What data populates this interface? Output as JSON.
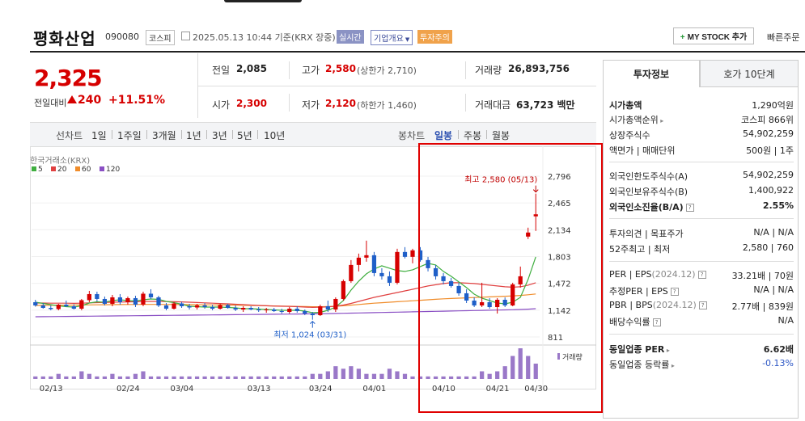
{
  "header": {
    "stock_name": "평화산업",
    "stock_code": "090080",
    "market": "코스피",
    "datetime": "2025.05.13 10:44 기준(KRX 장중)",
    "badges": [
      "실시간",
      "기업개요",
      "투자주의"
    ],
    "mystock_label": "MY STOCK 추가",
    "quick_order": "빠른주문"
  },
  "price": {
    "current": "2,325",
    "change_label": "전일대비",
    "change": "240",
    "change_pct": "+11.51%",
    "prev_close_label": "전일",
    "prev_close": "2,085",
    "high_label": "고가",
    "high": "2,580",
    "upper_limit": "(상한가 2,710)",
    "volume_label": "거래량",
    "volume": "26,893,756",
    "open_label": "시가",
    "open": "2,300",
    "low_label": "저가",
    "low": "2,120",
    "lower_limit": "(하한가 1,460)",
    "amount_label": "거래대금",
    "amount": "63,723",
    "amount_unit": "백만"
  },
  "period": {
    "left_label": "선차트",
    "left_items": [
      "1일",
      "1주일",
      "3개월",
      "1년",
      "3년",
      "5년",
      "10년"
    ],
    "right_label": "봉차트",
    "right_items": [
      "일봉",
      "주봉",
      "월봉"
    ],
    "active": "일봉"
  },
  "chart_data": {
    "type": "candlestick",
    "source_label": "한국거래소(KRX)",
    "ma_legend": [
      {
        "name": "5",
        "color": "#3fae3f"
      },
      {
        "name": "20",
        "color": "#e04040"
      },
      {
        "name": "60",
        "color": "#f08c2a"
      },
      {
        "name": "120",
        "color": "#8a4fc4"
      }
    ],
    "y_ticks": [
      "2,796",
      "2,465",
      "2,134",
      "1,803",
      "1,472",
      "1,142",
      "811"
    ],
    "ylim": [
      811,
      2796
    ],
    "x_ticks": [
      "02/13",
      "02/24",
      "03/04",
      "03/13",
      "03/24",
      "04/01",
      "04/10",
      "04/21",
      "04/30"
    ],
    "high_annotation": "최고 2,580 (05/13)",
    "low_annotation": "최저 1,024 (03/31)",
    "volume_label": "거래량",
    "up_color": "#d60000",
    "down_color": "#1f5fc8",
    "candles": [
      {
        "o": 1240,
        "h": 1270,
        "l": 1185,
        "c": 1200
      },
      {
        "o": 1200,
        "h": 1230,
        "l": 1160,
        "c": 1170
      },
      {
        "o": 1170,
        "h": 1200,
        "l": 1140,
        "c": 1155
      },
      {
        "o": 1155,
        "h": 1220,
        "l": 1140,
        "c": 1210
      },
      {
        "o": 1210,
        "h": 1260,
        "l": 1180,
        "c": 1190
      },
      {
        "o": 1190,
        "h": 1215,
        "l": 1150,
        "c": 1160
      },
      {
        "o": 1160,
        "h": 1280,
        "l": 1140,
        "c": 1265
      },
      {
        "o": 1265,
        "h": 1380,
        "l": 1240,
        "c": 1340
      },
      {
        "o": 1340,
        "h": 1370,
        "l": 1250,
        "c": 1280
      },
      {
        "o": 1280,
        "h": 1310,
        "l": 1200,
        "c": 1220
      },
      {
        "o": 1220,
        "h": 1330,
        "l": 1190,
        "c": 1300
      },
      {
        "o": 1300,
        "h": 1340,
        "l": 1210,
        "c": 1240
      },
      {
        "o": 1240,
        "h": 1310,
        "l": 1210,
        "c": 1290
      },
      {
        "o": 1290,
        "h": 1320,
        "l": 1180,
        "c": 1210
      },
      {
        "o": 1210,
        "h": 1370,
        "l": 1190,
        "c": 1345
      },
      {
        "o": 1345,
        "h": 1400,
        "l": 1280,
        "c": 1300
      },
      {
        "o": 1300,
        "h": 1320,
        "l": 1180,
        "c": 1200
      },
      {
        "o": 1200,
        "h": 1230,
        "l": 1140,
        "c": 1160
      },
      {
        "o": 1160,
        "h": 1240,
        "l": 1150,
        "c": 1225
      },
      {
        "o": 1225,
        "h": 1245,
        "l": 1170,
        "c": 1190
      },
      {
        "o": 1190,
        "h": 1220,
        "l": 1150,
        "c": 1175
      },
      {
        "o": 1175,
        "h": 1220,
        "l": 1150,
        "c": 1200
      },
      {
        "o": 1200,
        "h": 1230,
        "l": 1160,
        "c": 1180
      },
      {
        "o": 1180,
        "h": 1210,
        "l": 1140,
        "c": 1160
      },
      {
        "o": 1160,
        "h": 1220,
        "l": 1150,
        "c": 1205
      },
      {
        "o": 1205,
        "h": 1220,
        "l": 1160,
        "c": 1170
      },
      {
        "o": 1170,
        "h": 1200,
        "l": 1130,
        "c": 1150
      },
      {
        "o": 1150,
        "h": 1190,
        "l": 1120,
        "c": 1170
      },
      {
        "o": 1170,
        "h": 1190,
        "l": 1140,
        "c": 1150
      },
      {
        "o": 1150,
        "h": 1180,
        "l": 1120,
        "c": 1140
      },
      {
        "o": 1140,
        "h": 1170,
        "l": 1110,
        "c": 1150
      },
      {
        "o": 1150,
        "h": 1170,
        "l": 1120,
        "c": 1130
      },
      {
        "o": 1130,
        "h": 1160,
        "l": 1100,
        "c": 1120
      },
      {
        "o": 1120,
        "h": 1180,
        "l": 1100,
        "c": 1160
      },
      {
        "o": 1160,
        "h": 1190,
        "l": 1110,
        "c": 1130
      },
      {
        "o": 1130,
        "h": 1150,
        "l": 1080,
        "c": 1100
      },
      {
        "o": 1100,
        "h": 1120,
        "l": 1024,
        "c": 1080
      },
      {
        "o": 1080,
        "h": 1210,
        "l": 1070,
        "c": 1190
      },
      {
        "o": 1190,
        "h": 1260,
        "l": 1120,
        "c": 1150
      },
      {
        "o": 1150,
        "h": 1300,
        "l": 1120,
        "c": 1280
      },
      {
        "o": 1280,
        "h": 1520,
        "l": 1260,
        "c": 1500
      },
      {
        "o": 1500,
        "h": 1760,
        "l": 1480,
        "c": 1700
      },
      {
        "o": 1700,
        "h": 1840,
        "l": 1620,
        "c": 1790
      },
      {
        "o": 1790,
        "h": 2000,
        "l": 1740,
        "c": 1820
      },
      {
        "o": 1820,
        "h": 1860,
        "l": 1560,
        "c": 1600
      },
      {
        "o": 1600,
        "h": 1660,
        "l": 1520,
        "c": 1560
      },
      {
        "o": 1560,
        "h": 1620,
        "l": 1440,
        "c": 1480
      },
      {
        "o": 1480,
        "h": 1900,
        "l": 1460,
        "c": 1860
      },
      {
        "o": 1860,
        "h": 1920,
        "l": 1780,
        "c": 1800
      },
      {
        "o": 1800,
        "h": 1900,
        "l": 1720,
        "c": 1880
      },
      {
        "o": 1880,
        "h": 1920,
        "l": 1740,
        "c": 1760
      },
      {
        "o": 1760,
        "h": 1800,
        "l": 1620,
        "c": 1660
      },
      {
        "o": 1660,
        "h": 1700,
        "l": 1520,
        "c": 1560
      },
      {
        "o": 1560,
        "h": 1600,
        "l": 1460,
        "c": 1500
      },
      {
        "o": 1500,
        "h": 1540,
        "l": 1420,
        "c": 1440
      },
      {
        "o": 1440,
        "h": 1480,
        "l": 1320,
        "c": 1350
      },
      {
        "o": 1350,
        "h": 1400,
        "l": 1230,
        "c": 1260
      },
      {
        "o": 1260,
        "h": 1300,
        "l": 1180,
        "c": 1200
      },
      {
        "o": 1200,
        "h": 1480,
        "l": 1180,
        "c": 1240
      },
      {
        "o": 1240,
        "h": 1290,
        "l": 1160,
        "c": 1180
      },
      {
        "o": 1180,
        "h": 1290,
        "l": 1100,
        "c": 1270
      },
      {
        "o": 1270,
        "h": 1300,
        "l": 1180,
        "c": 1200
      },
      {
        "o": 1200,
        "h": 1480,
        "l": 1190,
        "c": 1460
      },
      {
        "o": 1460,
        "h": 1680,
        "l": 1420,
        "c": 1560
      },
      {
        "o": 2050,
        "h": 2160,
        "l": 2020,
        "c": 2100
      },
      {
        "o": 2300,
        "h": 2580,
        "l": 2120,
        "c": 2325
      }
    ],
    "volumes": [
      1,
      1,
      1,
      2,
      1,
      1,
      3,
      2,
      1,
      1,
      2,
      1,
      1,
      2,
      3,
      1,
      1,
      1,
      1,
      1,
      1,
      1,
      1,
      1,
      1,
      1,
      1,
      1,
      1,
      1,
      1,
      1,
      1,
      1,
      1,
      1,
      2,
      2,
      3,
      5,
      4,
      5,
      4,
      2,
      2,
      2,
      4,
      3,
      2,
      1,
      1,
      1,
      1,
      1,
      1,
      1,
      1,
      1,
      3,
      2,
      3,
      5,
      9,
      12,
      9,
      6
    ],
    "ma5": [
      1240,
      1225,
      1210,
      1195,
      1185,
      1180,
      1195,
      1230,
      1245,
      1240,
      1260,
      1270,
      1260,
      1255,
      1270,
      1280,
      1275,
      1250,
      1235,
      1215,
      1190,
      1185,
      1180,
      1180,
      1180,
      1175,
      1170,
      1160,
      1160,
      1155,
      1150,
      1145,
      1140,
      1140,
      1140,
      1130,
      1110,
      1115,
      1140,
      1180,
      1260,
      1390,
      1500,
      1590,
      1650,
      1690,
      1660,
      1630,
      1620,
      1640,
      1680,
      1720,
      1700,
      1620,
      1560,
      1490,
      1420,
      1340,
      1290,
      1260,
      1230,
      1220,
      1240,
      1300,
      1520,
      1800
    ],
    "ma20": [
      1230,
      1230,
      1228,
      1228,
      1228,
      1226,
      1228,
      1232,
      1235,
      1237,
      1240,
      1242,
      1244,
      1246,
      1248,
      1250,
      1250,
      1248,
      1246,
      1244,
      1240,
      1236,
      1232,
      1228,
      1224,
      1220,
      1215,
      1210,
      1205,
      1200,
      1196,
      1192,
      1190,
      1188,
      1185,
      1180,
      1176,
      1178,
      1182,
      1190,
      1205,
      1225,
      1250,
      1275,
      1300,
      1320,
      1340,
      1360,
      1380,
      1400,
      1420,
      1440,
      1455,
      1470,
      1480,
      1480,
      1475,
      1470,
      1460,
      1450,
      1440,
      1430,
      1425,
      1430,
      1450,
      1480
    ],
    "ma60": [
      1200,
      1201,
      1202,
      1203,
      1204,
      1205,
      1206,
      1207,
      1208,
      1209,
      1210,
      1211,
      1212,
      1212,
      1213,
      1213,
      1213,
      1212,
      1212,
      1211,
      1210,
      1209,
      1208,
      1207,
      1206,
      1205,
      1204,
      1202,
      1200,
      1198,
      1196,
      1194,
      1192,
      1190,
      1188,
      1186,
      1184,
      1184,
      1186,
      1190,
      1196,
      1204,
      1212,
      1220,
      1228,
      1234,
      1240,
      1246,
      1252,
      1258,
      1264,
      1270,
      1276,
      1282,
      1286,
      1290,
      1294,
      1298,
      1302,
      1306,
      1310,
      1314,
      1318,
      1324,
      1332,
      1342
    ],
    "ma120": [
      1060,
      1061,
      1062,
      1063,
      1064,
      1065,
      1066,
      1067,
      1068,
      1069,
      1070,
      1071,
      1072,
      1073,
      1074,
      1075,
      1076,
      1077,
      1078,
      1079,
      1080,
      1081,
      1082,
      1083,
      1084,
      1085,
      1086,
      1087,
      1088,
      1089,
      1090,
      1091,
      1092,
      1093,
      1094,
      1095,
      1096,
      1097,
      1099,
      1101,
      1103,
      1105,
      1107,
      1109,
      1111,
      1113,
      1115,
      1117,
      1119,
      1121,
      1123,
      1125,
      1127,
      1129,
      1131,
      1133,
      1135,
      1137,
      1139,
      1141,
      1143,
      1145,
      1147,
      1150,
      1154,
      1160
    ]
  },
  "tabs": [
    "투자정보",
    "호가 10단계"
  ],
  "info": {
    "market_cap_label": "시가총액",
    "market_cap": "1,290억원",
    "cap_rank_label": "시가총액순위",
    "cap_rank": "코스피 866위",
    "listed_shares_label": "상장주식수",
    "listed_shares": "54,902,259",
    "par_label": "액면가 | 매매단위",
    "par": "500원 | 1주",
    "foreign_limit_label": "외국인한도주식수(A)",
    "foreign_limit": "54,902,259",
    "foreign_hold_label": "외국인보유주식수(B)",
    "foreign_hold": "1,400,922",
    "foreign_rate_label": "외국인소진율(B/A)",
    "foreign_rate": "2.55%",
    "opinion_label": "투자의견 | 목표주가",
    "opinion": "N/A | N/A",
    "w52_label": "52주최고 | 최저",
    "w52": "2,580 | 760",
    "per_label": "PER | EPS",
    "per_period": "(2024.12)",
    "per": "33.21배 | 70원",
    "est_per_label": "추정PER | EPS",
    "est_per": "N/A | N/A",
    "pbr_label": "PBR | BPS",
    "pbr_period": "(2024.12)",
    "pbr": "2.77배 | 839원",
    "dividend_label": "배당수익률",
    "dividend": "N/A",
    "industry_per_label": "동일업종 PER",
    "industry_per": "6.62배",
    "industry_rate_label": "동일업종 등락률",
    "industry_rate": "-0.13%"
  }
}
